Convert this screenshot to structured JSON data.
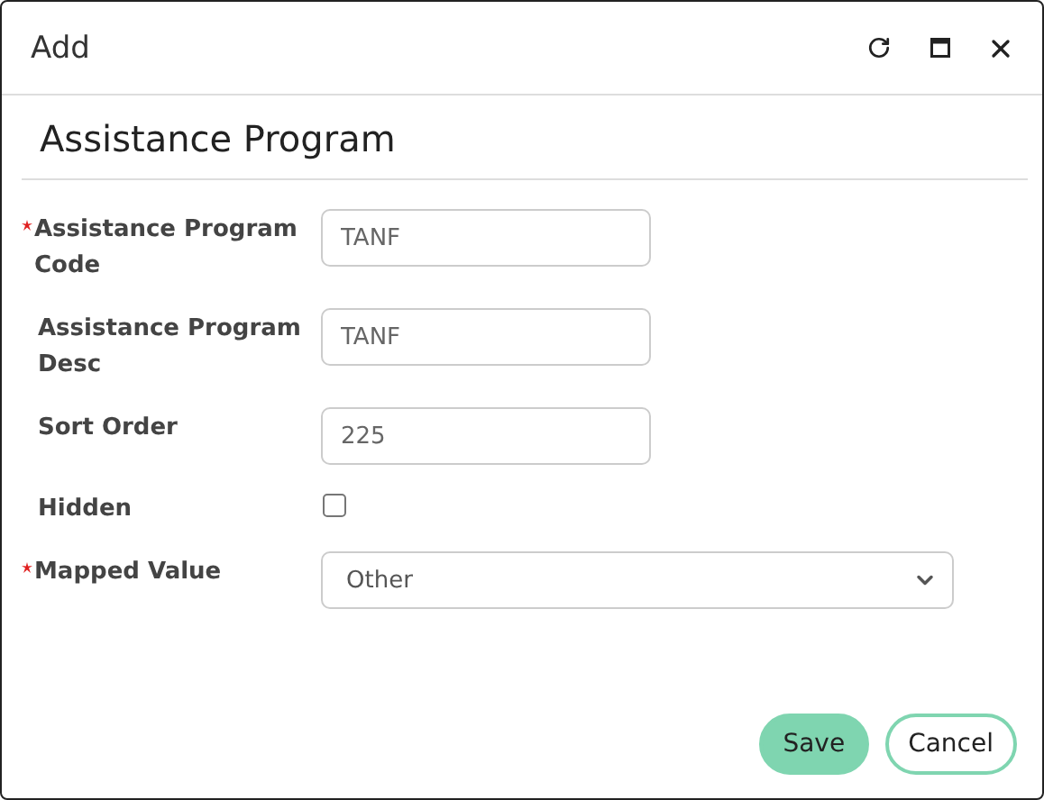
{
  "window": {
    "title": "Add"
  },
  "form": {
    "heading": "Assistance Program",
    "fields": [
      {
        "kind": "text",
        "label": "Assistance Program Code",
        "required": true,
        "value": "TANF"
      },
      {
        "kind": "text",
        "label": "Assistance Program Desc",
        "required": false,
        "value": "TANF"
      },
      {
        "kind": "text",
        "label": "Sort Order",
        "required": false,
        "value": "225"
      },
      {
        "kind": "checkbox",
        "label": "Hidden",
        "required": false,
        "checked": false
      },
      {
        "kind": "select",
        "label": "Mapped Value",
        "required": true,
        "value": "Other"
      }
    ]
  },
  "buttons": [
    {
      "kind": "primary",
      "label": "Save"
    },
    {
      "kind": "secondary",
      "label": "Cancel"
    }
  ]
}
